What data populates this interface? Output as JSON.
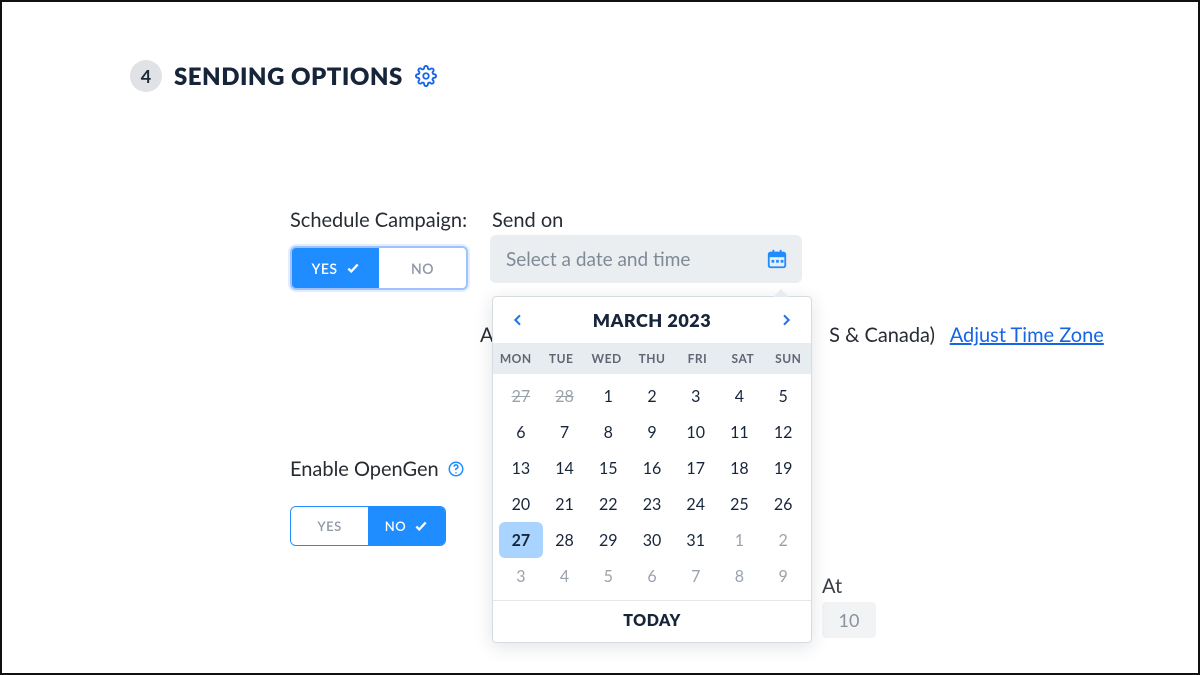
{
  "section": {
    "step": "4",
    "title": "SENDING OPTIONS"
  },
  "schedule": {
    "label": "Schedule Campaign:",
    "yes": "YES",
    "no": "NO"
  },
  "sendon": {
    "label": "Send on",
    "placeholder": "Select a date and time"
  },
  "timezone": {
    "prefix_obscured": "A",
    "visible_tail": "S & Canada)",
    "link": "Adjust Time Zone"
  },
  "opengen": {
    "label": "Enable OpenGen",
    "yes": "YES",
    "no": "NO"
  },
  "at": {
    "label": "At",
    "hour": "10"
  },
  "datepicker": {
    "month_label": "MARCH 2023",
    "dow": [
      "MON",
      "TUE",
      "WED",
      "THU",
      "FRI",
      "SAT",
      "SUN"
    ],
    "days": [
      {
        "d": "27",
        "t": "prev-strike"
      },
      {
        "d": "28",
        "t": "prev-strike"
      },
      {
        "d": "1",
        "t": "cur"
      },
      {
        "d": "2",
        "t": "cur"
      },
      {
        "d": "3",
        "t": "cur"
      },
      {
        "d": "4",
        "t": "cur"
      },
      {
        "d": "5",
        "t": "cur"
      },
      {
        "d": "6",
        "t": "cur"
      },
      {
        "d": "7",
        "t": "cur"
      },
      {
        "d": "8",
        "t": "cur"
      },
      {
        "d": "9",
        "t": "cur"
      },
      {
        "d": "10",
        "t": "cur"
      },
      {
        "d": "11",
        "t": "cur"
      },
      {
        "d": "12",
        "t": "cur"
      },
      {
        "d": "13",
        "t": "cur"
      },
      {
        "d": "14",
        "t": "cur"
      },
      {
        "d": "15",
        "t": "cur"
      },
      {
        "d": "16",
        "t": "cur"
      },
      {
        "d": "17",
        "t": "cur"
      },
      {
        "d": "18",
        "t": "cur"
      },
      {
        "d": "19",
        "t": "cur"
      },
      {
        "d": "20",
        "t": "cur"
      },
      {
        "d": "21",
        "t": "cur"
      },
      {
        "d": "22",
        "t": "cur"
      },
      {
        "d": "23",
        "t": "cur"
      },
      {
        "d": "24",
        "t": "cur"
      },
      {
        "d": "25",
        "t": "cur"
      },
      {
        "d": "26",
        "t": "cur"
      },
      {
        "d": "27",
        "t": "cur",
        "sel": true
      },
      {
        "d": "28",
        "t": "cur"
      },
      {
        "d": "29",
        "t": "cur"
      },
      {
        "d": "30",
        "t": "cur"
      },
      {
        "d": "31",
        "t": "cur"
      },
      {
        "d": "1",
        "t": "next"
      },
      {
        "d": "2",
        "t": "next"
      },
      {
        "d": "3",
        "t": "next"
      },
      {
        "d": "4",
        "t": "next"
      },
      {
        "d": "5",
        "t": "next"
      },
      {
        "d": "6",
        "t": "next"
      },
      {
        "d": "7",
        "t": "next"
      },
      {
        "d": "8",
        "t": "next"
      },
      {
        "d": "9",
        "t": "next"
      }
    ],
    "today": "TODAY"
  }
}
